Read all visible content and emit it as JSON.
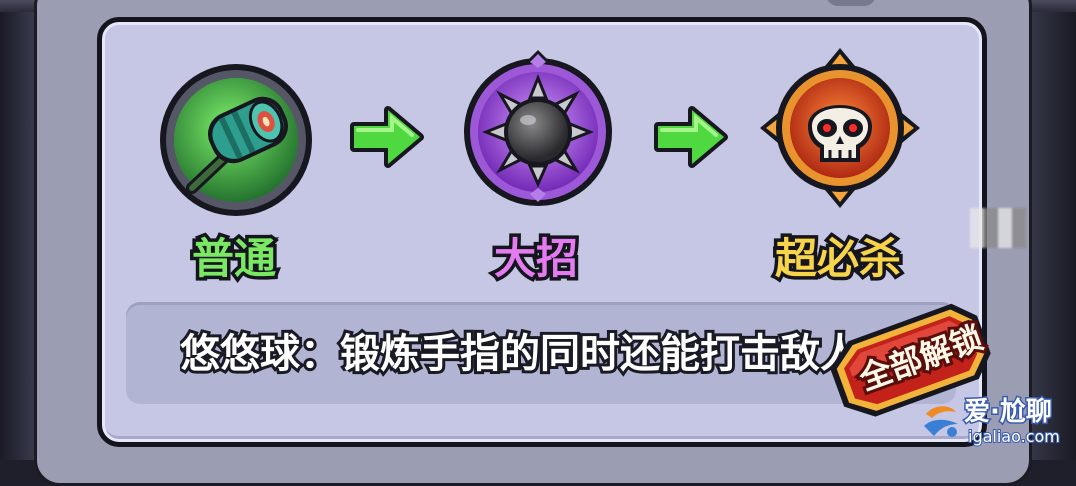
{
  "skills": [
    {
      "name": "普通",
      "icon": "yoyo-icon",
      "label_color": "#7be864"
    },
    {
      "name": "大招",
      "icon": "spiked-ball-icon",
      "label_color": "#e47bf0"
    },
    {
      "name": "超必杀",
      "icon": "skull-icon",
      "label_color": "#f7d44a"
    }
  ],
  "description": "悠悠球：锻炼手指的同时还能打击敌人",
  "unlock_button": {
    "label": "全部解锁"
  },
  "watermark": {
    "text": "爱·尬聊",
    "url": "igaliao.com"
  },
  "colors": {
    "panel": "#c6c7e5",
    "arrow": "#4fd840",
    "unlock_button": "#c3221b"
  }
}
